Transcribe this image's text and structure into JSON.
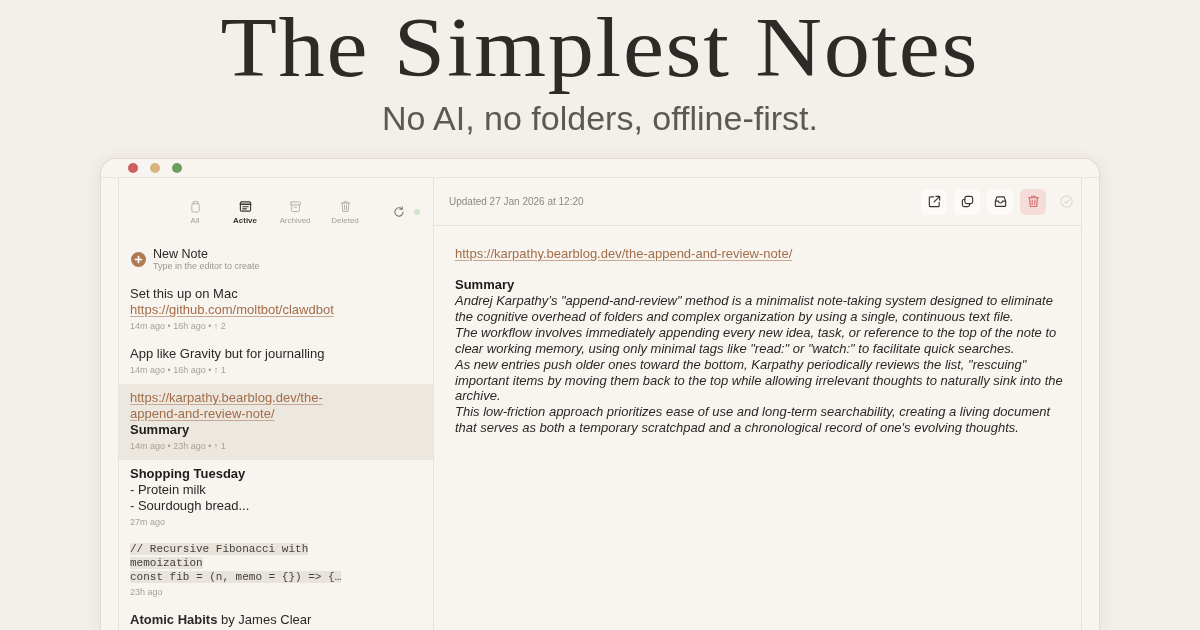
{
  "hero": {
    "title": "The Simplest Notes",
    "subtitle": "No AI, no folders, offline-first."
  },
  "sidebar": {
    "tabs": [
      {
        "label": "All",
        "selected": false
      },
      {
        "label": "Active",
        "selected": true
      },
      {
        "label": "Archived",
        "selected": false
      },
      {
        "label": "Deleted",
        "selected": false
      }
    ],
    "new_note": {
      "title": "New Note",
      "hint": "Type in the editor to create"
    },
    "notes": [
      {
        "selected": false,
        "lines": [
          {
            "kind": "text",
            "text": "Set this up on Mac"
          },
          {
            "kind": "link",
            "text": "https://github.com/moltbot/clawdbot"
          }
        ],
        "meta": "14m ago • 16h ago • ↑ 2"
      },
      {
        "selected": false,
        "lines": [
          {
            "kind": "text",
            "text": "App like Gravity but for journalling"
          }
        ],
        "meta": "14m ago • 16h ago • ↑ 1"
      },
      {
        "selected": true,
        "lines": [
          {
            "kind": "link",
            "text": "https://karpathy.bearblog.dev/the-append-and-review-note/"
          },
          {
            "kind": "heading",
            "text": "Summary"
          }
        ],
        "meta": "14m ago • 23h ago • ↑ 1"
      },
      {
        "selected": false,
        "lines": [
          {
            "kind": "heading",
            "text": "Shopping Tuesday"
          },
          {
            "kind": "text",
            "text": "- Protein milk"
          },
          {
            "kind": "text",
            "text": "- Sourdough bread..."
          }
        ],
        "meta": "27m ago"
      },
      {
        "selected": false,
        "lines": [
          {
            "kind": "code",
            "text": "// Recursive Fibonacci with memoization"
          },
          {
            "kind": "code",
            "text": "const fib = (n, memo = {}) => {…"
          }
        ],
        "meta": "23h ago"
      },
      {
        "selected": false,
        "lines": [
          {
            "kind": "text",
            "text": "**Atomic Habits** by James Clear"
          }
        ]
      }
    ]
  },
  "editor": {
    "updated": "Updated 27 Jan 2026 at 12:20",
    "actions": [
      {
        "disabled": false,
        "highlighted": false
      },
      {
        "disabled": false,
        "highlighted": false
      },
      {
        "disabled": false,
        "highlighted": false
      },
      {
        "disabled": false,
        "highlighted": true
      },
      {
        "disabled": true,
        "highlighted": false
      }
    ],
    "link": "https://karpathy.bearblog.dev/the-append-and-review-note/",
    "heading": "Summary",
    "paragraphs": [
      "Andrej Karpathy’s \"append-and-review\" method is a minimalist note-taking system designed to eliminate the cognitive overhead of folders and complex organization by using a single, continuous text file.",
      "The workflow involves immediately appending every new idea, task, or reference to the top of the note to clear working memory, using only minimal tags like \"read:\" or \"watch:\" to facilitate quick searches.",
      "As new entries push older ones toward the bottom, Karpathy periodically reviews the list, \"rescuing\" important items by moving them back to the top while allowing irrelevant thoughts to naturally sink into the archive.",
      "This low-friction approach prioritizes ease of use and long-term searchability, creating a living document that serves as both a temporary scratchpad and a chronological record of one's evolving thoughts."
    ]
  }
}
